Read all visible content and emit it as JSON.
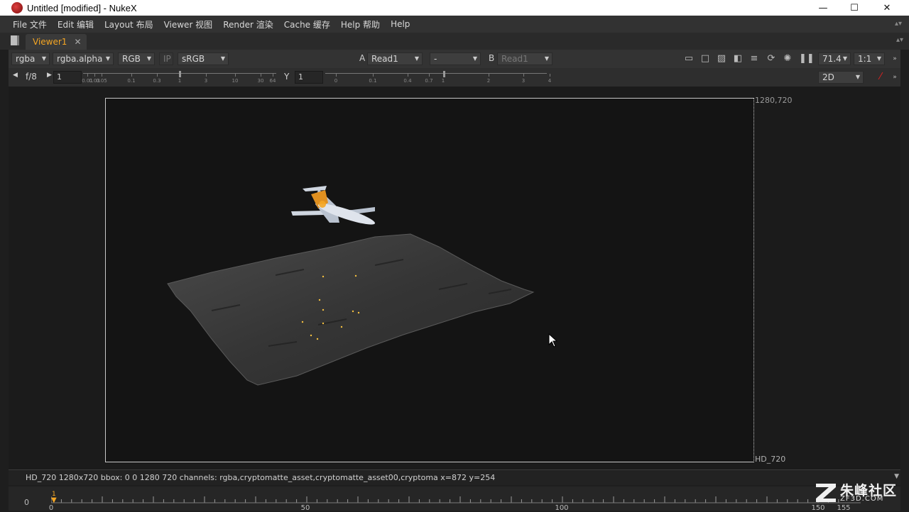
{
  "window": {
    "title": "Untitled [modified] - NukeX",
    "minimize": "—",
    "maximize": "☐",
    "close": "✕"
  },
  "menu": [
    {
      "label": "File 文件"
    },
    {
      "label": "Edit 编辑"
    },
    {
      "label": "Layout 布局"
    },
    {
      "label": "Viewer 视图"
    },
    {
      "label": "Render 渲染"
    },
    {
      "label": "Cache 缓存"
    },
    {
      "label": "Help 帮助"
    },
    {
      "label": "Help"
    }
  ],
  "tabs": {
    "active": "Viewer1",
    "close": "✕"
  },
  "toolbar": {
    "channels": "rgba",
    "alpha_channel": "rgba.alpha",
    "display_channels": "RGB",
    "ip": "IP",
    "colorspace": "sRGB",
    "input_a_label": "A",
    "input_a": "Read1",
    "composite_op": "-",
    "input_b_label": "B",
    "input_b": "Read1",
    "zoom": "71.4",
    "proxy": "1:1"
  },
  "exposure": {
    "fstop": "f/8",
    "gain_value": "1",
    "gain_ticks": [
      "0.01",
      "0.03",
      "0.05",
      "0.1",
      "0.3",
      "1",
      "3",
      "10",
      "30",
      "64"
    ],
    "gamma_label": "Y",
    "gamma_value": "1",
    "gamma_ticks": [
      "0",
      "0.1",
      "0.4",
      "0.7",
      "1",
      "2",
      "3",
      "4"
    ],
    "view_mode": "2D"
  },
  "viewer": {
    "format_top": "1280,720",
    "format_bottom": "HD_720"
  },
  "info_bar": {
    "text": "HD_720 1280x720  bbox: 0 0 1280 720 channels: rgba,cryptomatte_asset,cryptomatte_asset00,cryptoma  x=872 y=254"
  },
  "timeline": {
    "start": "0",
    "current": "1",
    "marks": [
      "0",
      "50",
      "100",
      "150",
      "155"
    ]
  },
  "watermark": {
    "title": "朱峰社区",
    "url": "ZF3D.COM"
  },
  "colors": {
    "accent": "#f5a623",
    "viewer_bg": "#141414"
  }
}
